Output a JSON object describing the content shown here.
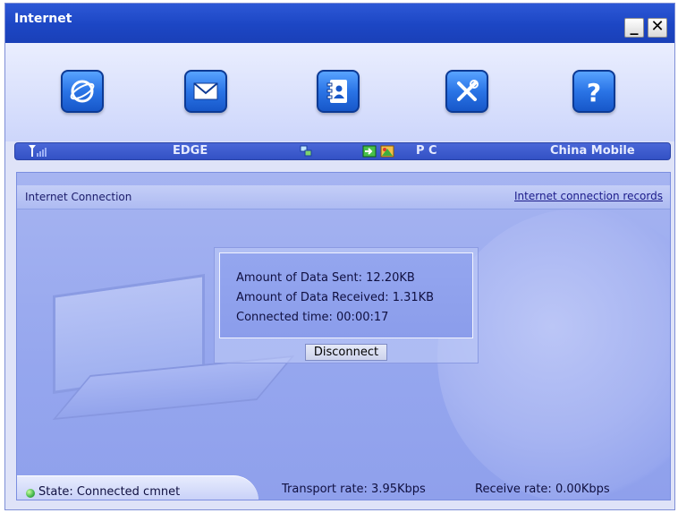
{
  "window": {
    "title": "Internet"
  },
  "titlebar": {
    "minimize_label": "_",
    "close_label": "✕"
  },
  "toolbar": {
    "buttons": [
      {
        "name": "internet",
        "icon": "internet-icon"
      },
      {
        "name": "messages",
        "icon": "envelope-icon"
      },
      {
        "name": "contacts",
        "icon": "contacts-book-icon"
      },
      {
        "name": "settings",
        "icon": "tools-icon"
      },
      {
        "name": "help",
        "icon": "help-icon"
      }
    ]
  },
  "statusbar": {
    "network_type": "EDGE",
    "mode": "P C",
    "operator": "China Mobile",
    "icons": [
      "signal-strength-icon",
      "network-icon",
      "sim-icon",
      "pc-connection-icon"
    ]
  },
  "panel": {
    "title": "Internet Connection",
    "records_link": "Internet connection records"
  },
  "stats": {
    "sent": "Amount of Data Sent: 12.20KB",
    "received": "Amount of Data Received: 1.31KB",
    "time": "Connected time: 00:00:17"
  },
  "actions": {
    "disconnect_label": "Disconnect"
  },
  "footer": {
    "state": "State: Connected cmnet",
    "transport_rate": "Transport rate: 3.95Kbps",
    "receive_rate": "Receive rate: 0.00Kbps"
  },
  "colors": {
    "titlebar": "#1c46c4",
    "statusbar": "#3351c4",
    "panel": "#95a6ee",
    "button": "#2a74e6"
  }
}
